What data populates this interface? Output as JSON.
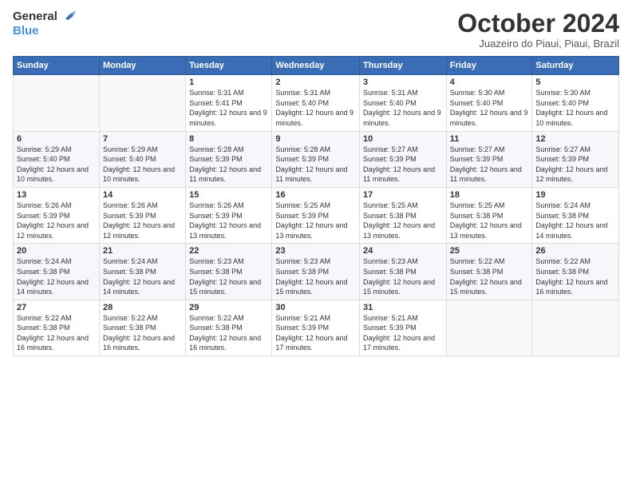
{
  "header": {
    "logo_general": "General",
    "logo_blue": "Blue",
    "month_title": "October 2024",
    "subtitle": "Juazeiro do Piaui, Piaui, Brazil"
  },
  "weekdays": [
    "Sunday",
    "Monday",
    "Tuesday",
    "Wednesday",
    "Thursday",
    "Friday",
    "Saturday"
  ],
  "weeks": [
    [
      {
        "num": "",
        "sunrise": "",
        "sunset": "",
        "daylight": ""
      },
      {
        "num": "",
        "sunrise": "",
        "sunset": "",
        "daylight": ""
      },
      {
        "num": "1",
        "sunrise": "Sunrise: 5:31 AM",
        "sunset": "Sunset: 5:41 PM",
        "daylight": "Daylight: 12 hours and 9 minutes."
      },
      {
        "num": "2",
        "sunrise": "Sunrise: 5:31 AM",
        "sunset": "Sunset: 5:40 PM",
        "daylight": "Daylight: 12 hours and 9 minutes."
      },
      {
        "num": "3",
        "sunrise": "Sunrise: 5:31 AM",
        "sunset": "Sunset: 5:40 PM",
        "daylight": "Daylight: 12 hours and 9 minutes."
      },
      {
        "num": "4",
        "sunrise": "Sunrise: 5:30 AM",
        "sunset": "Sunset: 5:40 PM",
        "daylight": "Daylight: 12 hours and 9 minutes."
      },
      {
        "num": "5",
        "sunrise": "Sunrise: 5:30 AM",
        "sunset": "Sunset: 5:40 PM",
        "daylight": "Daylight: 12 hours and 10 minutes."
      }
    ],
    [
      {
        "num": "6",
        "sunrise": "Sunrise: 5:29 AM",
        "sunset": "Sunset: 5:40 PM",
        "daylight": "Daylight: 12 hours and 10 minutes."
      },
      {
        "num": "7",
        "sunrise": "Sunrise: 5:29 AM",
        "sunset": "Sunset: 5:40 PM",
        "daylight": "Daylight: 12 hours and 10 minutes."
      },
      {
        "num": "8",
        "sunrise": "Sunrise: 5:28 AM",
        "sunset": "Sunset: 5:39 PM",
        "daylight": "Daylight: 12 hours and 11 minutes."
      },
      {
        "num": "9",
        "sunrise": "Sunrise: 5:28 AM",
        "sunset": "Sunset: 5:39 PM",
        "daylight": "Daylight: 12 hours and 11 minutes."
      },
      {
        "num": "10",
        "sunrise": "Sunrise: 5:27 AM",
        "sunset": "Sunset: 5:39 PM",
        "daylight": "Daylight: 12 hours and 11 minutes."
      },
      {
        "num": "11",
        "sunrise": "Sunrise: 5:27 AM",
        "sunset": "Sunset: 5:39 PM",
        "daylight": "Daylight: 12 hours and 11 minutes."
      },
      {
        "num": "12",
        "sunrise": "Sunrise: 5:27 AM",
        "sunset": "Sunset: 5:39 PM",
        "daylight": "Daylight: 12 hours and 12 minutes."
      }
    ],
    [
      {
        "num": "13",
        "sunrise": "Sunrise: 5:26 AM",
        "sunset": "Sunset: 5:39 PM",
        "daylight": "Daylight: 12 hours and 12 minutes."
      },
      {
        "num": "14",
        "sunrise": "Sunrise: 5:26 AM",
        "sunset": "Sunset: 5:39 PM",
        "daylight": "Daylight: 12 hours and 12 minutes."
      },
      {
        "num": "15",
        "sunrise": "Sunrise: 5:26 AM",
        "sunset": "Sunset: 5:39 PM",
        "daylight": "Daylight: 12 hours and 13 minutes."
      },
      {
        "num": "16",
        "sunrise": "Sunrise: 5:25 AM",
        "sunset": "Sunset: 5:39 PM",
        "daylight": "Daylight: 12 hours and 13 minutes."
      },
      {
        "num": "17",
        "sunrise": "Sunrise: 5:25 AM",
        "sunset": "Sunset: 5:38 PM",
        "daylight": "Daylight: 12 hours and 13 minutes."
      },
      {
        "num": "18",
        "sunrise": "Sunrise: 5:25 AM",
        "sunset": "Sunset: 5:38 PM",
        "daylight": "Daylight: 12 hours and 13 minutes."
      },
      {
        "num": "19",
        "sunrise": "Sunrise: 5:24 AM",
        "sunset": "Sunset: 5:38 PM",
        "daylight": "Daylight: 12 hours and 14 minutes."
      }
    ],
    [
      {
        "num": "20",
        "sunrise": "Sunrise: 5:24 AM",
        "sunset": "Sunset: 5:38 PM",
        "daylight": "Daylight: 12 hours and 14 minutes."
      },
      {
        "num": "21",
        "sunrise": "Sunrise: 5:24 AM",
        "sunset": "Sunset: 5:38 PM",
        "daylight": "Daylight: 12 hours and 14 minutes."
      },
      {
        "num": "22",
        "sunrise": "Sunrise: 5:23 AM",
        "sunset": "Sunset: 5:38 PM",
        "daylight": "Daylight: 12 hours and 15 minutes."
      },
      {
        "num": "23",
        "sunrise": "Sunrise: 5:23 AM",
        "sunset": "Sunset: 5:38 PM",
        "daylight": "Daylight: 12 hours and 15 minutes."
      },
      {
        "num": "24",
        "sunrise": "Sunrise: 5:23 AM",
        "sunset": "Sunset: 5:38 PM",
        "daylight": "Daylight: 12 hours and 15 minutes."
      },
      {
        "num": "25",
        "sunrise": "Sunrise: 5:22 AM",
        "sunset": "Sunset: 5:38 PM",
        "daylight": "Daylight: 12 hours and 15 minutes."
      },
      {
        "num": "26",
        "sunrise": "Sunrise: 5:22 AM",
        "sunset": "Sunset: 5:38 PM",
        "daylight": "Daylight: 12 hours and 16 minutes."
      }
    ],
    [
      {
        "num": "27",
        "sunrise": "Sunrise: 5:22 AM",
        "sunset": "Sunset: 5:38 PM",
        "daylight": "Daylight: 12 hours and 16 minutes."
      },
      {
        "num": "28",
        "sunrise": "Sunrise: 5:22 AM",
        "sunset": "Sunset: 5:38 PM",
        "daylight": "Daylight: 12 hours and 16 minutes."
      },
      {
        "num": "29",
        "sunrise": "Sunrise: 5:22 AM",
        "sunset": "Sunset: 5:38 PM",
        "daylight": "Daylight: 12 hours and 16 minutes."
      },
      {
        "num": "30",
        "sunrise": "Sunrise: 5:21 AM",
        "sunset": "Sunset: 5:39 PM",
        "daylight": "Daylight: 12 hours and 17 minutes."
      },
      {
        "num": "31",
        "sunrise": "Sunrise: 5:21 AM",
        "sunset": "Sunset: 5:39 PM",
        "daylight": "Daylight: 12 hours and 17 minutes."
      },
      {
        "num": "",
        "sunrise": "",
        "sunset": "",
        "daylight": ""
      },
      {
        "num": "",
        "sunrise": "",
        "sunset": "",
        "daylight": ""
      }
    ]
  ]
}
